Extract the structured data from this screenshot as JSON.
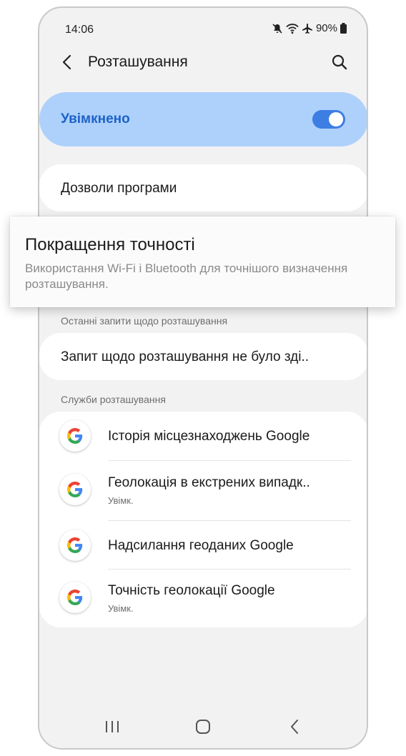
{
  "status_bar": {
    "time": "14:06",
    "battery": "90%"
  },
  "app_bar": {
    "title": "Розташування"
  },
  "master_switch": {
    "label": "Увімкнено",
    "checked": true
  },
  "permissions": {
    "label": "Дозволи програми"
  },
  "accuracy_popup": {
    "title": "Покращення точності",
    "description": "Використання Wi-Fi і Bluetooth для точнішого визначення розташування."
  },
  "recent_requests": {
    "header": "Останні запити щодо розташування",
    "item": "Запит щодо розташування не було зді.."
  },
  "location_services": {
    "header": "Служби розташування",
    "items": [
      {
        "title": "Історія місцезнаходжень Google",
        "subtitle": ""
      },
      {
        "title": "Геолокація в екстрених випадк..",
        "subtitle": "Увімк."
      },
      {
        "title": "Надсилання геоданих Google",
        "subtitle": ""
      },
      {
        "title": "Точність геолокації Google",
        "subtitle": "Увімк."
      }
    ]
  },
  "colors": {
    "accent": "#3d7ee3",
    "master_bg": "#aed1fb",
    "master_text": "#1e62c8",
    "background": "#f2f2f2"
  },
  "icons": [
    "mute-icon",
    "wifi-icon",
    "airplane-icon",
    "battery-icon",
    "back-arrow-icon",
    "search-icon",
    "google-g-icon",
    "recents-icon",
    "home-icon",
    "back-nav-icon"
  ]
}
